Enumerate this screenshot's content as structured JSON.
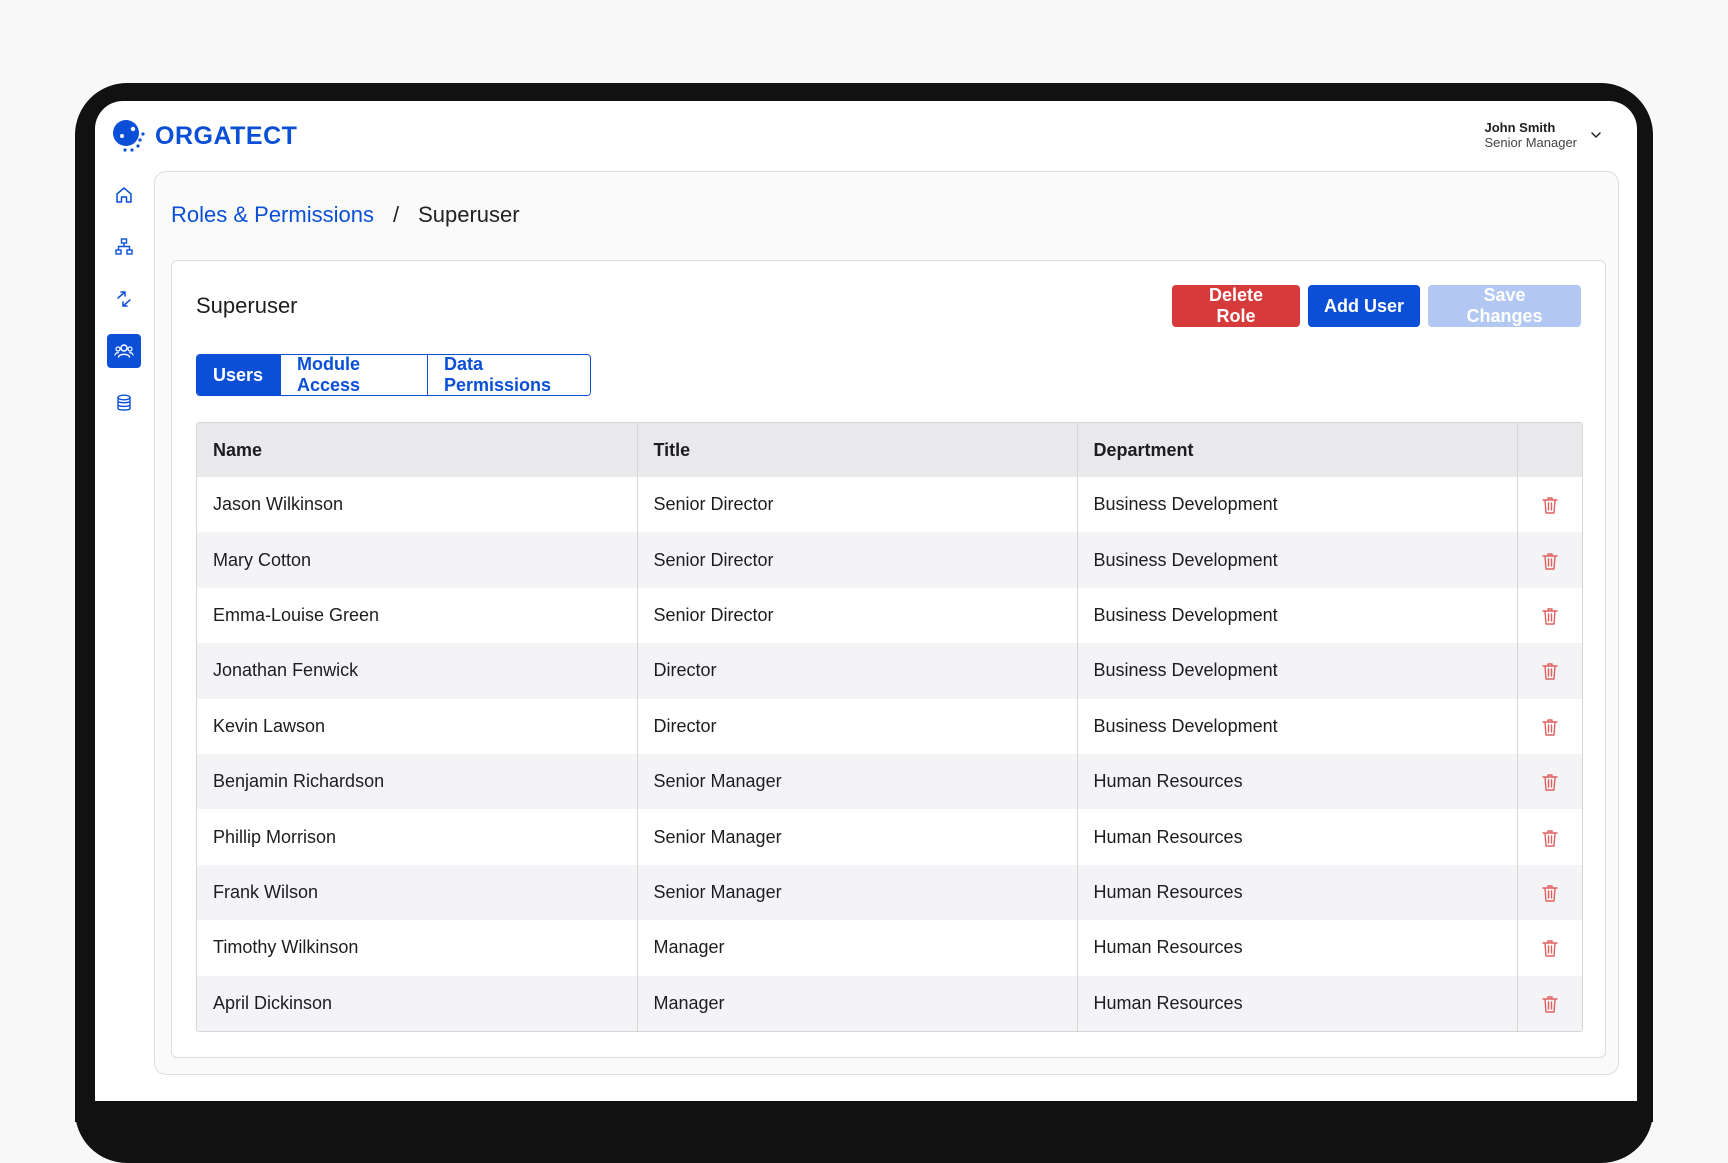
{
  "brand": {
    "name": "ORGATECT",
    "color": "#0a4fd6"
  },
  "user": {
    "name": "John Smith",
    "title": "Senior Manager"
  },
  "sidebar": {
    "items": [
      {
        "icon": "home-icon",
        "active": false
      },
      {
        "icon": "org-chart-icon",
        "active": false
      },
      {
        "icon": "transfer-icon",
        "active": false
      },
      {
        "icon": "users-icon",
        "active": true
      },
      {
        "icon": "database-icon",
        "active": false
      }
    ]
  },
  "breadcrumb": {
    "parent": "Roles & Permissions",
    "separator": "/",
    "current": "Superuser"
  },
  "card": {
    "title": "Superuser",
    "actions": {
      "delete": "Delete Role",
      "add": "Add User",
      "save": "Save Changes"
    },
    "tabs": [
      {
        "label": "Users",
        "active": true
      },
      {
        "label": "Module Access",
        "active": false
      },
      {
        "label": "Data Permissions",
        "active": false
      }
    ]
  },
  "table": {
    "headers": [
      "Name",
      "Title",
      "Department",
      ""
    ],
    "rows": [
      [
        "Jason Wilkinson",
        "Senior Director",
        "Business Development"
      ],
      [
        "Mary Cotton",
        "Senior Director",
        "Business Development"
      ],
      [
        "Emma-Louise Green",
        "Senior Director",
        "Business Development"
      ],
      [
        "Jonathan Fenwick",
        "Director",
        "Business Development"
      ],
      [
        "Kevin Lawson",
        "Director",
        "Business Development"
      ],
      [
        "Benjamin Richardson",
        "Senior Manager",
        "Human Resources"
      ],
      [
        "Phillip Morrison",
        "Senior Manager",
        "Human Resources"
      ],
      [
        "Frank Wilson",
        "Senior Manager",
        "Human Resources"
      ],
      [
        "Timothy Wilkinson",
        "Manager",
        "Human Resources"
      ],
      [
        "April Dickinson",
        "Manager",
        "Human Resources"
      ]
    ]
  },
  "colors": {
    "primary": "#0a4fd6",
    "danger": "#d63a3a",
    "disabled": "#b2c8f2",
    "trash": "#e06060"
  }
}
